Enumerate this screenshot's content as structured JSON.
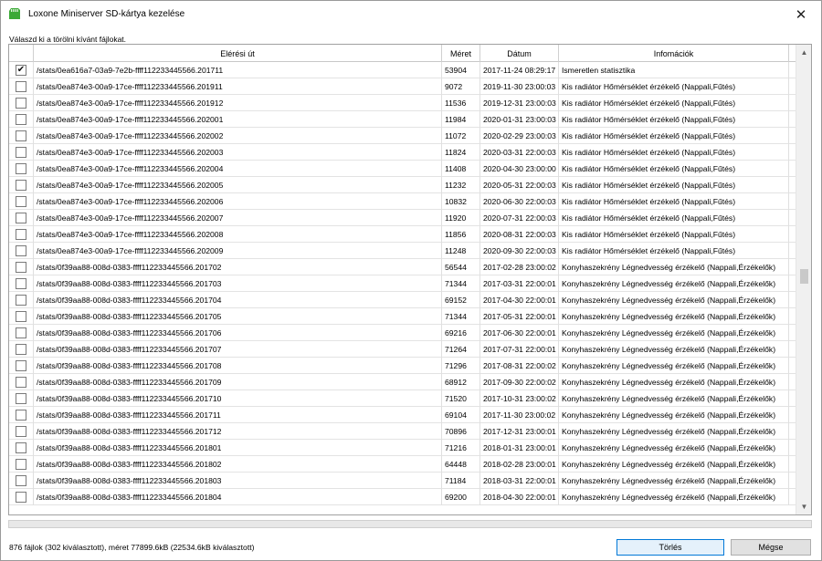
{
  "window": {
    "title": "Loxone Miniserver SD-kártya kezelése",
    "close_glyph": "✕"
  },
  "instruction": "Válaszd ki a törölni kívánt fájlokat.",
  "table": {
    "columns": [
      "",
      "Elérési út",
      "Méret",
      "Dátum",
      "Infomációk"
    ],
    "rows": [
      {
        "checked": true,
        "path": "/stats/0ea616a7-03a9-7e2b-ffff112233445566.201711",
        "size": "53904",
        "date": "2017-11-24 08:29:17",
        "info": "Ismeretlen statisztika"
      },
      {
        "checked": false,
        "path": "/stats/0ea874e3-00a9-17ce-ffff112233445566.201911",
        "size": "9072",
        "date": "2019-11-30 23:00:03",
        "info": "Kis radiátor Hőmérséklet érzékelő (Nappali,Fűtés)"
      },
      {
        "checked": false,
        "path": "/stats/0ea874e3-00a9-17ce-ffff112233445566.201912",
        "size": "11536",
        "date": "2019-12-31 23:00:03",
        "info": "Kis radiátor Hőmérséklet érzékelő (Nappali,Fűtés)"
      },
      {
        "checked": false,
        "path": "/stats/0ea874e3-00a9-17ce-ffff112233445566.202001",
        "size": "11984",
        "date": "2020-01-31 23:00:03",
        "info": "Kis radiátor Hőmérséklet érzékelő (Nappali,Fűtés)"
      },
      {
        "checked": false,
        "path": "/stats/0ea874e3-00a9-17ce-ffff112233445566.202002",
        "size": "11072",
        "date": "2020-02-29 23:00:03",
        "info": "Kis radiátor Hőmérséklet érzékelő (Nappali,Fűtés)"
      },
      {
        "checked": false,
        "path": "/stats/0ea874e3-00a9-17ce-ffff112233445566.202003",
        "size": "11824",
        "date": "2020-03-31 22:00:03",
        "info": "Kis radiátor Hőmérséklet érzékelő (Nappali,Fűtés)"
      },
      {
        "checked": false,
        "path": "/stats/0ea874e3-00a9-17ce-ffff112233445566.202004",
        "size": "11408",
        "date": "2020-04-30 23:00:00",
        "info": "Kis radiátor Hőmérséklet érzékelő (Nappali,Fűtés)"
      },
      {
        "checked": false,
        "path": "/stats/0ea874e3-00a9-17ce-ffff112233445566.202005",
        "size": "11232",
        "date": "2020-05-31 22:00:03",
        "info": "Kis radiátor Hőmérséklet érzékelő (Nappali,Fűtés)"
      },
      {
        "checked": false,
        "path": "/stats/0ea874e3-00a9-17ce-ffff112233445566.202006",
        "size": "10832",
        "date": "2020-06-30 22:00:03",
        "info": "Kis radiátor Hőmérséklet érzékelő (Nappali,Fűtés)"
      },
      {
        "checked": false,
        "path": "/stats/0ea874e3-00a9-17ce-ffff112233445566.202007",
        "size": "11920",
        "date": "2020-07-31 22:00:03",
        "info": "Kis radiátor Hőmérséklet érzékelő (Nappali,Fűtés)"
      },
      {
        "checked": false,
        "path": "/stats/0ea874e3-00a9-17ce-ffff112233445566.202008",
        "size": "11856",
        "date": "2020-08-31 22:00:03",
        "info": "Kis radiátor Hőmérséklet érzékelő (Nappali,Fűtés)"
      },
      {
        "checked": false,
        "path": "/stats/0ea874e3-00a9-17ce-ffff112233445566.202009",
        "size": "11248",
        "date": "2020-09-30 22:00:03",
        "info": "Kis radiátor Hőmérséklet érzékelő (Nappali,Fűtés)"
      },
      {
        "checked": false,
        "path": "/stats/0f39aa88-008d-0383-ffff112233445566.201702",
        "size": "56544",
        "date": "2017-02-28 23:00:02",
        "info": "Konyhaszekrény Légnedvesség érzékelő (Nappali,Érzékelők)"
      },
      {
        "checked": false,
        "path": "/stats/0f39aa88-008d-0383-ffff112233445566.201703",
        "size": "71344",
        "date": "2017-03-31 22:00:01",
        "info": "Konyhaszekrény Légnedvesség érzékelő (Nappali,Érzékelők)"
      },
      {
        "checked": false,
        "path": "/stats/0f39aa88-008d-0383-ffff112233445566.201704",
        "size": "69152",
        "date": "2017-04-30 22:00:01",
        "info": "Konyhaszekrény Légnedvesség érzékelő (Nappali,Érzékelők)"
      },
      {
        "checked": false,
        "path": "/stats/0f39aa88-008d-0383-ffff112233445566.201705",
        "size": "71344",
        "date": "2017-05-31 22:00:01",
        "info": "Konyhaszekrény Légnedvesség érzékelő (Nappali,Érzékelők)"
      },
      {
        "checked": false,
        "path": "/stats/0f39aa88-008d-0383-ffff112233445566.201706",
        "size": "69216",
        "date": "2017-06-30 22:00:01",
        "info": "Konyhaszekrény Légnedvesség érzékelő (Nappali,Érzékelők)"
      },
      {
        "checked": false,
        "path": "/stats/0f39aa88-008d-0383-ffff112233445566.201707",
        "size": "71264",
        "date": "2017-07-31 22:00:01",
        "info": "Konyhaszekrény Légnedvesség érzékelő (Nappali,Érzékelők)"
      },
      {
        "checked": false,
        "path": "/stats/0f39aa88-008d-0383-ffff112233445566.201708",
        "size": "71296",
        "date": "2017-08-31 22:00:02",
        "info": "Konyhaszekrény Légnedvesség érzékelő (Nappali,Érzékelők)"
      },
      {
        "checked": false,
        "path": "/stats/0f39aa88-008d-0383-ffff112233445566.201709",
        "size": "68912",
        "date": "2017-09-30 22:00:02",
        "info": "Konyhaszekrény Légnedvesség érzékelő (Nappali,Érzékelők)"
      },
      {
        "checked": false,
        "path": "/stats/0f39aa88-008d-0383-ffff112233445566.201710",
        "size": "71520",
        "date": "2017-10-31 23:00:02",
        "info": "Konyhaszekrény Légnedvesség érzékelő (Nappali,Érzékelők)"
      },
      {
        "checked": false,
        "path": "/stats/0f39aa88-008d-0383-ffff112233445566.201711",
        "size": "69104",
        "date": "2017-11-30 23:00:02",
        "info": "Konyhaszekrény Légnedvesség érzékelő (Nappali,Érzékelők)"
      },
      {
        "checked": false,
        "path": "/stats/0f39aa88-008d-0383-ffff112233445566.201712",
        "size": "70896",
        "date": "2017-12-31 23:00:01",
        "info": "Konyhaszekrény Légnedvesség érzékelő (Nappali,Érzékelők)"
      },
      {
        "checked": false,
        "path": "/stats/0f39aa88-008d-0383-ffff112233445566.201801",
        "size": "71216",
        "date": "2018-01-31 23:00:01",
        "info": "Konyhaszekrény Légnedvesség érzékelő (Nappali,Érzékelők)"
      },
      {
        "checked": false,
        "path": "/stats/0f39aa88-008d-0383-ffff112233445566.201802",
        "size": "64448",
        "date": "2018-02-28 23:00:01",
        "info": "Konyhaszekrény Légnedvesség érzékelő (Nappali,Érzékelők)"
      },
      {
        "checked": false,
        "path": "/stats/0f39aa88-008d-0383-ffff112233445566.201803",
        "size": "71184",
        "date": "2018-03-31 22:00:01",
        "info": "Konyhaszekrény Légnedvesség érzékelő (Nappali,Érzékelők)"
      },
      {
        "checked": false,
        "path": "/stats/0f39aa88-008d-0383-ffff112233445566.201804",
        "size": "69200",
        "date": "2018-04-30 22:00:01",
        "info": "Konyhaszekrény Légnedvesség érzékelő (Nappali,Érzékelők)"
      }
    ]
  },
  "scrollbar": {
    "up_glyph": "▲",
    "down_glyph": "▼"
  },
  "progress": {
    "value_percent": 0,
    "color": "#06b025"
  },
  "status": "876 fájlok (302 kiválasztott), méret 77899.6kB (22534.6kB kiválasztott)",
  "buttons": {
    "delete_label": "Törlés",
    "cancel_label": "Mégse"
  },
  "icons": {
    "app": "sd-card-icon",
    "check_glyph": "✔"
  },
  "colors": {
    "app_icon": "#3aa935",
    "accent": "#0078d7"
  }
}
